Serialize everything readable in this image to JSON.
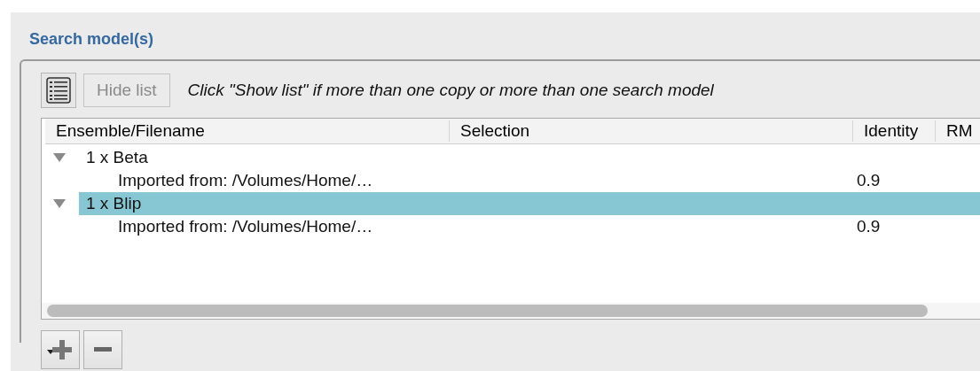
{
  "section_title": "Search model(s)",
  "toolbar": {
    "hide_list_button": {
      "label": "Hide list",
      "disabled": true
    },
    "hint": "Click \"Show list\" if more than one copy or more than one search model"
  },
  "table": {
    "columns": [
      "Ensemble/Filename",
      "Selection",
      "Identity",
      "RM"
    ],
    "rows": [
      {
        "label": "1 x Beta",
        "expanded": true,
        "selected": false,
        "children": [
          {
            "label": "Imported from: /Volumes/Home/…",
            "identity": "0.9"
          }
        ]
      },
      {
        "label": "1 x Blip",
        "expanded": true,
        "selected": true,
        "children": [
          {
            "label": "Imported from: /Volumes/Home/…",
            "identity": "0.9"
          }
        ]
      }
    ]
  }
}
